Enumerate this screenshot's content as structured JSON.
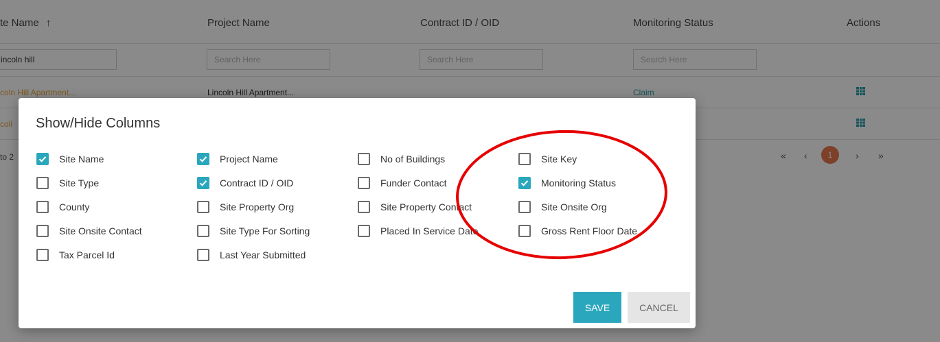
{
  "table": {
    "headers": {
      "site_name": "te Name",
      "sort_arrow": "↑",
      "project_name": "Project Name",
      "contract_id": "Contract ID / OID",
      "monitoring_status": "Monitoring Status",
      "actions": "Actions"
    },
    "filters": {
      "site_name_value": "incoln hill",
      "placeholder": "Search Here"
    },
    "rows": [
      {
        "site_name": "coln Hill Apartment...",
        "project_name": "Lincoln Hill Apartment...",
        "monitoring_status": "Claim"
      },
      {
        "site_name": "coli",
        "project_name": "",
        "monitoring_status": ""
      }
    ],
    "footer_text": "to 2",
    "pager": {
      "first": "«",
      "prev": "‹",
      "page": "1",
      "next": "›",
      "last": "»"
    }
  },
  "modal": {
    "title": "Show/Hide Columns",
    "columns": [
      [
        {
          "label": "Site Name",
          "checked": true
        },
        {
          "label": "Site Type",
          "checked": false
        },
        {
          "label": "County",
          "checked": false
        },
        {
          "label": "Site Onsite Contact",
          "checked": false
        },
        {
          "label": "Tax Parcel Id",
          "checked": false
        }
      ],
      [
        {
          "label": "Project Name",
          "checked": true
        },
        {
          "label": "Contract ID / OID",
          "checked": true
        },
        {
          "label": "Site Property Org",
          "checked": false
        },
        {
          "label": "Site Type For Sorting",
          "checked": false
        },
        {
          "label": "Last Year Submitted",
          "checked": false
        }
      ],
      [
        {
          "label": "No of Buildings",
          "checked": false
        },
        {
          "label": "Funder Contact",
          "checked": false
        },
        {
          "label": "Site Property Contact",
          "checked": false
        },
        {
          "label": "Placed In Service Date",
          "checked": false
        }
      ],
      [
        {
          "label": "Site Key",
          "checked": false
        },
        {
          "label": "Monitoring Status",
          "checked": true
        },
        {
          "label": "Site Onsite Org",
          "checked": false
        },
        {
          "label": "Gross Rent Floor Date",
          "checked": false
        }
      ]
    ],
    "save_label": "SAVE",
    "cancel_label": "CANCEL"
  },
  "colors": {
    "accent": "#2ba7bd",
    "link_orange": "#e8a33c",
    "link_teal": "#2b9aa8",
    "pager_active": "#e8764a",
    "annotation_red": "#e60000"
  }
}
